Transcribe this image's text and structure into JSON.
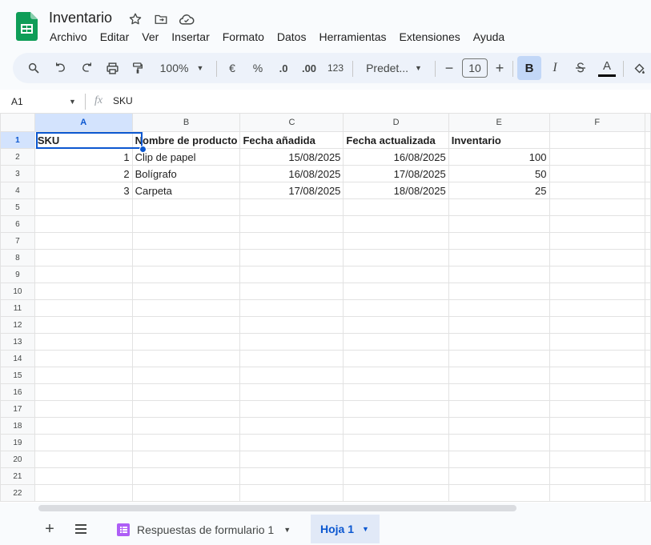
{
  "app": {
    "title": "Inventario"
  },
  "menu": [
    "Archivo",
    "Editar",
    "Ver",
    "Insertar",
    "Formato",
    "Datos",
    "Herramientas",
    "Extensiones",
    "Ayuda"
  ],
  "toolbar": {
    "zoom": "100%",
    "currency": "€",
    "percent": "%",
    "dec_less": ".0",
    "dec_more": ".00",
    "num_format": "123",
    "font": "Predet...",
    "font_size": "10",
    "bold": "B",
    "italic": "I",
    "text_color": "A"
  },
  "formula_bar": {
    "cell_ref": "A1",
    "fx": "fx",
    "content": "SKU"
  },
  "columns": [
    "A",
    "B",
    "C",
    "D",
    "E",
    "F"
  ],
  "rows": [
    [
      "SKU",
      "Nombre de producto",
      "Fecha añadida",
      "Fecha actualizada",
      "Inventario",
      ""
    ],
    [
      "1",
      "Clip de papel",
      "15/08/2025",
      "16/08/2025",
      "100",
      ""
    ],
    [
      "2",
      "Bolígrafo",
      "16/08/2025",
      "17/08/2025",
      "50",
      ""
    ],
    [
      "3",
      "Carpeta",
      "17/08/2025",
      "18/08/2025",
      "25",
      ""
    ],
    [
      "",
      "",
      "",
      "",
      "",
      ""
    ],
    [
      "",
      "",
      "",
      "",
      "",
      ""
    ],
    [
      "",
      "",
      "",
      "",
      "",
      ""
    ],
    [
      "",
      "",
      "",
      "",
      "",
      ""
    ],
    [
      "",
      "",
      "",
      "",
      "",
      ""
    ],
    [
      "",
      "",
      "",
      "",
      "",
      ""
    ],
    [
      "",
      "",
      "",
      "",
      "",
      ""
    ],
    [
      "",
      "",
      "",
      "",
      "",
      ""
    ],
    [
      "",
      "",
      "",
      "",
      "",
      ""
    ],
    [
      "",
      "",
      "",
      "",
      "",
      ""
    ],
    [
      "",
      "",
      "",
      "",
      "",
      ""
    ],
    [
      "",
      "",
      "",
      "",
      "",
      ""
    ],
    [
      "",
      "",
      "",
      "",
      "",
      ""
    ],
    [
      "",
      "",
      "",
      "",
      "",
      ""
    ],
    [
      "",
      "",
      "",
      "",
      "",
      ""
    ],
    [
      "",
      "",
      "",
      "",
      "",
      ""
    ],
    [
      "",
      "",
      "",
      "",
      "",
      ""
    ],
    [
      "",
      "",
      "",
      "",
      "",
      ""
    ]
  ],
  "row_numbers": [
    "1",
    "2",
    "3",
    "4",
    "5",
    "6",
    "7",
    "8",
    "9",
    "10",
    "11",
    "12",
    "13",
    "14",
    "15",
    "16",
    "17",
    "18",
    "19",
    "20",
    "21",
    "22"
  ],
  "sheets": [
    {
      "label": "Respuestas de formulario 1",
      "active": false
    },
    {
      "label": "Hoja 1",
      "active": true
    }
  ],
  "colors": {
    "accent": "#0b57d0",
    "sheets_green": "#0f9d58",
    "selected_header": "#d3e3fd"
  }
}
